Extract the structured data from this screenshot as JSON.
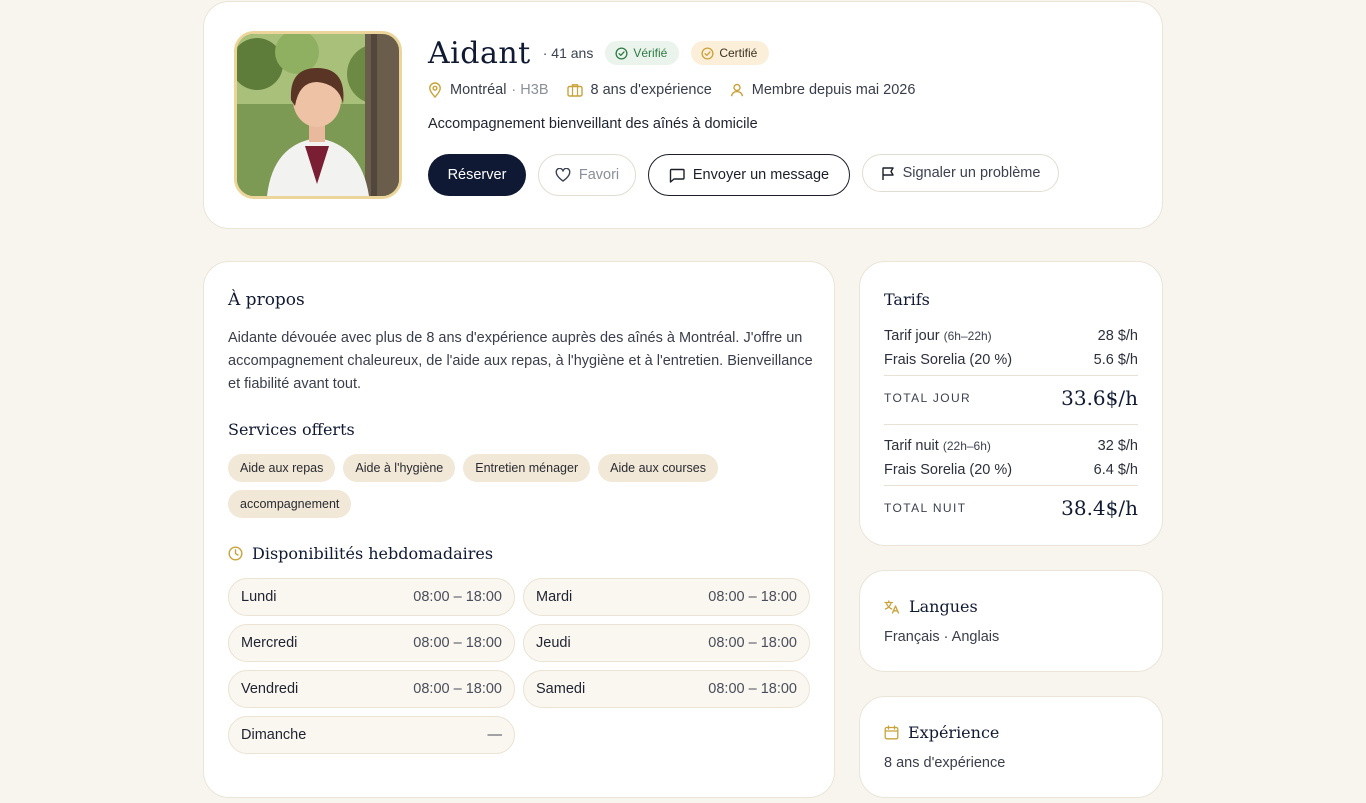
{
  "profile": {
    "name": "Aidant",
    "age": "· 41 ans",
    "badges": {
      "verified": "Vérifié",
      "certified": "Certifié"
    },
    "city": "Montréal",
    "postal": "· H3B",
    "experience": "8 ans d'expérience",
    "member_since": "Membre depuis mai 2026",
    "tagline": "Accompagnement bienveillant des aînés à domicile",
    "actions": {
      "book": "Réserver",
      "favorite": "Favori",
      "message": "Envoyer un message",
      "report": "Signaler un problème"
    }
  },
  "about": {
    "title": "À propos",
    "text": "Aidante dévouée avec plus de 8 ans d'expérience auprès des aînés à Montréal. J'offre un accompagnement chaleureux, de l'aide aux repas, à l'hygiène et à l'entretien. Bienveillance et fiabilité avant tout.",
    "services_title": "Services offerts",
    "services": [
      "Aide aux repas",
      "Aide à l'hygiène",
      "Entretien ménager",
      "Aide aux courses",
      "accompagnement"
    ],
    "availability_title": "Disponibilités hebdomadaires",
    "days": [
      {
        "day": "Lundi",
        "hours": "08:00 – 18:00"
      },
      {
        "day": "Mardi",
        "hours": "08:00 – 18:00"
      },
      {
        "day": "Mercredi",
        "hours": "08:00 – 18:00"
      },
      {
        "day": "Jeudi",
        "hours": "08:00 – 18:00"
      },
      {
        "day": "Vendredi",
        "hours": "08:00 – 18:00"
      },
      {
        "day": "Samedi",
        "hours": "08:00 – 18:00"
      },
      {
        "day": "Dimanche",
        "hours": "—"
      }
    ]
  },
  "tarifs": {
    "title": "Tarifs",
    "day_rate_label": "Tarif jour",
    "day_rate_hours": "(6h–22h)",
    "day_rate": "28 $/h",
    "day_fee_label": "Frais Sorelia (20 %)",
    "day_fee": "5.6 $/h",
    "day_total_label": "TOTAL JOUR",
    "day_total": "33.6$/h",
    "night_rate_label": "Tarif nuit",
    "night_rate_hours": "(22h–6h)",
    "night_rate": "32 $/h",
    "night_fee_label": "Frais Sorelia (20 %)",
    "night_fee": "6.4 $/h",
    "night_total_label": "TOTAL NUIT",
    "night_total": "38.4$/h"
  },
  "langues": {
    "title": "Langues",
    "value": "Français · Anglais"
  },
  "experience_card": {
    "title": "Expérience",
    "value": "8 ans d'expérience"
  },
  "colors": {
    "background": "#f8f5ee",
    "primary": "#0f1934",
    "accent_gold": "#c9a23a",
    "verified_green": "#2f7a45",
    "chip": "#f1e8d8"
  }
}
